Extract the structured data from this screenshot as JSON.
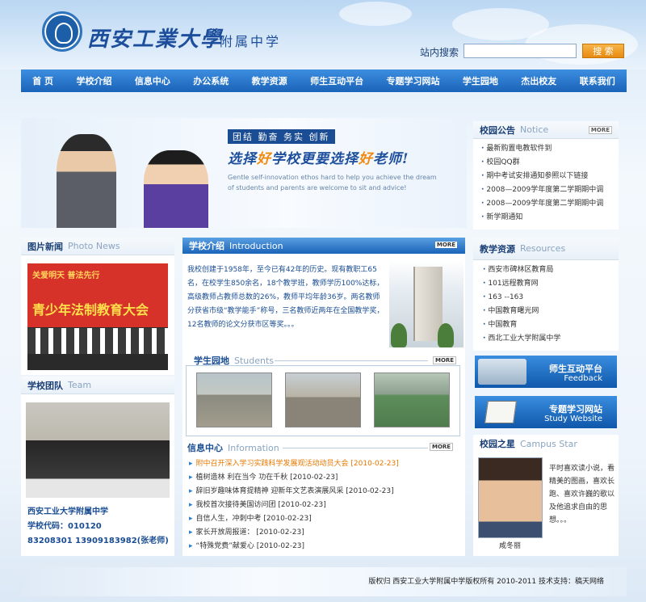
{
  "header": {
    "school_main": "西安工業大學",
    "school_sub": "附属中学",
    "search_label": "站内搜索",
    "search_button": "搜 索"
  },
  "nav": [
    "首 页",
    "学校介绍",
    "信息中心",
    "办公系统",
    "教学资源",
    "师生互动平台",
    "专题学习网站",
    "学生园地",
    "杰出校友",
    "联系我们"
  ],
  "banner": {
    "tag": "团结 勤奋 务实 创新",
    "slogan_a": "选择",
    "slogan_b": "好",
    "slogan_c": "学校更要选择",
    "slogan_d": "好",
    "slogan_e": "老师!",
    "slogan_en": "Gentle self-innovation ethos hard to help you achieve the dream of students and parents are welcome to sit and advice!"
  },
  "notice": {
    "title": "校园公告",
    "title_en": "Notice",
    "more": "MORE",
    "items": [
      "最新购置电教软件到",
      "校园QQ群",
      "期中考试安排通知参照以下链接",
      "2008—2009学年度第二学期期中调",
      "2008—2009学年度第二学期期中调",
      "新学期通知"
    ]
  },
  "photo_news": {
    "title": "图片新闻",
    "title_en": "Photo News",
    "banner_text": "青少年法制教育大会",
    "banner_top": "关爱明天   普法先行"
  },
  "team": {
    "title": "学校团队",
    "title_en": "Team",
    "line1": "西安工业大学附属中学",
    "line2": "学校代码：010120",
    "line3": "83208301   13909183982(张老师)"
  },
  "intro": {
    "title": "学校介绍",
    "title_en": "Introduction",
    "more": "MORE",
    "text": "我校创建于1958年，至今已有42年的历史。现有教职工65名，在校学生850余名，18个教学班，教师学历100%达标，高级教师占教师总数的26%，教师平均年龄36岁。两名教师分获省市级“教学能手”称号，三名教师近两年在全国教学奖，12名教师的论文分获市区等奖。。。"
  },
  "students": {
    "title": "学生园地",
    "title_en": "Students",
    "more": "MORE"
  },
  "info": {
    "title": "信息中心",
    "title_en": "Information",
    "more": "MORE",
    "items": [
      "附中召开深入学习实践科学发展观活动动员大会 [2010-02-23]",
      "植树造林 利在当今 功在千秋 [2010-02-23]",
      "辞旧岁趣味体育提精神 迎新年文艺表演展风采 [2010-02-23]",
      "我校首次接待美国访问团 [2010-02-23]",
      "自信人生，冲刺中考 [2010-02-23]",
      "家长开放周报道： [2010-02-23]",
      "“特殊党费”献爱心 [2010-02-23]"
    ]
  },
  "resources": {
    "title": "教学资源",
    "title_en": "Resources",
    "items": [
      "西安市碑林区教育局",
      "101远程教育网",
      "163 --163",
      "中国教育曙光网",
      "中国教育",
      "西北工业大学附属中学"
    ]
  },
  "feedback": {
    "cn": "师生互动平台",
    "en": "Feedback"
  },
  "study": {
    "cn": "专题学习网站",
    "en": "Study Website"
  },
  "star": {
    "title": "校园之星",
    "title_en": "Campus Star",
    "name": "咸冬丽",
    "text": "平时喜欢读小说，看精美的图画，喜欢长跑、喜欢许巍的歌以及他追求自由的思想。。。"
  },
  "footer": {
    "text": "版权归 西安工业大学附属中学版权所有 2010-2011   技术支持：稿天网络"
  }
}
